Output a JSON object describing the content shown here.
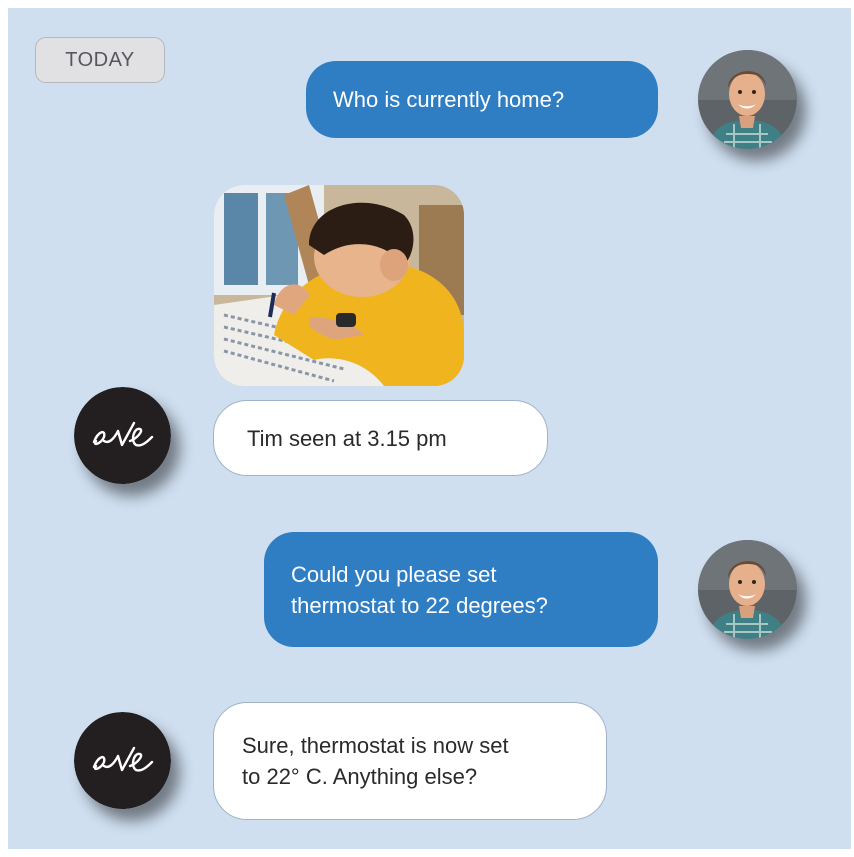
{
  "chat": {
    "date_label": "TODAY",
    "messages": [
      {
        "sender": "user",
        "text": "Who is currently home?"
      },
      {
        "sender": "eve",
        "attachment": "photo-boy-writing",
        "text": "Tim seen at 3.15 pm"
      },
      {
        "sender": "user",
        "lines": [
          "Could you please set",
          "thermostat to 22 degrees?"
        ]
      },
      {
        "sender": "eve",
        "lines": [
          "Sure, thermostat is now set",
          "to 22° C. Anything else?"
        ]
      }
    ]
  },
  "assistant": {
    "logo_text": "eve",
    "avatar_color": "#231f20"
  },
  "colors": {
    "background": "#cfdff0",
    "outgoing_bubble": "#2f7ec4",
    "incoming_bubble": "#ffffff",
    "date_chip": "#e1e1e4"
  },
  "icons": {
    "user_avatar": "user-avatar-photo",
    "assistant_avatar": "eve-logo-icon"
  }
}
